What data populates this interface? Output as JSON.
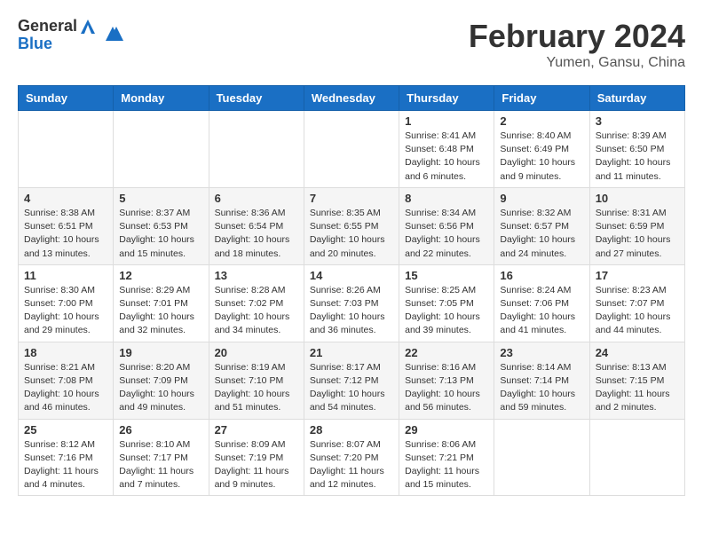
{
  "header": {
    "logo_general": "General",
    "logo_blue": "Blue",
    "month_title": "February 2024",
    "subtitle": "Yumen, Gansu, China"
  },
  "weekdays": [
    "Sunday",
    "Monday",
    "Tuesday",
    "Wednesday",
    "Thursday",
    "Friday",
    "Saturday"
  ],
  "weeks": [
    [
      {
        "day": "",
        "info": ""
      },
      {
        "day": "",
        "info": ""
      },
      {
        "day": "",
        "info": ""
      },
      {
        "day": "",
        "info": ""
      },
      {
        "day": "1",
        "info": "Sunrise: 8:41 AM\nSunset: 6:48 PM\nDaylight: 10 hours\nand 6 minutes."
      },
      {
        "day": "2",
        "info": "Sunrise: 8:40 AM\nSunset: 6:49 PM\nDaylight: 10 hours\nand 9 minutes."
      },
      {
        "day": "3",
        "info": "Sunrise: 8:39 AM\nSunset: 6:50 PM\nDaylight: 10 hours\nand 11 minutes."
      }
    ],
    [
      {
        "day": "4",
        "info": "Sunrise: 8:38 AM\nSunset: 6:51 PM\nDaylight: 10 hours\nand 13 minutes."
      },
      {
        "day": "5",
        "info": "Sunrise: 8:37 AM\nSunset: 6:53 PM\nDaylight: 10 hours\nand 15 minutes."
      },
      {
        "day": "6",
        "info": "Sunrise: 8:36 AM\nSunset: 6:54 PM\nDaylight: 10 hours\nand 18 minutes."
      },
      {
        "day": "7",
        "info": "Sunrise: 8:35 AM\nSunset: 6:55 PM\nDaylight: 10 hours\nand 20 minutes."
      },
      {
        "day": "8",
        "info": "Sunrise: 8:34 AM\nSunset: 6:56 PM\nDaylight: 10 hours\nand 22 minutes."
      },
      {
        "day": "9",
        "info": "Sunrise: 8:32 AM\nSunset: 6:57 PM\nDaylight: 10 hours\nand 24 minutes."
      },
      {
        "day": "10",
        "info": "Sunrise: 8:31 AM\nSunset: 6:59 PM\nDaylight: 10 hours\nand 27 minutes."
      }
    ],
    [
      {
        "day": "11",
        "info": "Sunrise: 8:30 AM\nSunset: 7:00 PM\nDaylight: 10 hours\nand 29 minutes."
      },
      {
        "day": "12",
        "info": "Sunrise: 8:29 AM\nSunset: 7:01 PM\nDaylight: 10 hours\nand 32 minutes."
      },
      {
        "day": "13",
        "info": "Sunrise: 8:28 AM\nSunset: 7:02 PM\nDaylight: 10 hours\nand 34 minutes."
      },
      {
        "day": "14",
        "info": "Sunrise: 8:26 AM\nSunset: 7:03 PM\nDaylight: 10 hours\nand 36 minutes."
      },
      {
        "day": "15",
        "info": "Sunrise: 8:25 AM\nSunset: 7:05 PM\nDaylight: 10 hours\nand 39 minutes."
      },
      {
        "day": "16",
        "info": "Sunrise: 8:24 AM\nSunset: 7:06 PM\nDaylight: 10 hours\nand 41 minutes."
      },
      {
        "day": "17",
        "info": "Sunrise: 8:23 AM\nSunset: 7:07 PM\nDaylight: 10 hours\nand 44 minutes."
      }
    ],
    [
      {
        "day": "18",
        "info": "Sunrise: 8:21 AM\nSunset: 7:08 PM\nDaylight: 10 hours\nand 46 minutes."
      },
      {
        "day": "19",
        "info": "Sunrise: 8:20 AM\nSunset: 7:09 PM\nDaylight: 10 hours\nand 49 minutes."
      },
      {
        "day": "20",
        "info": "Sunrise: 8:19 AM\nSunset: 7:10 PM\nDaylight: 10 hours\nand 51 minutes."
      },
      {
        "day": "21",
        "info": "Sunrise: 8:17 AM\nSunset: 7:12 PM\nDaylight: 10 hours\nand 54 minutes."
      },
      {
        "day": "22",
        "info": "Sunrise: 8:16 AM\nSunset: 7:13 PM\nDaylight: 10 hours\nand 56 minutes."
      },
      {
        "day": "23",
        "info": "Sunrise: 8:14 AM\nSunset: 7:14 PM\nDaylight: 10 hours\nand 59 minutes."
      },
      {
        "day": "24",
        "info": "Sunrise: 8:13 AM\nSunset: 7:15 PM\nDaylight: 11 hours\nand 2 minutes."
      }
    ],
    [
      {
        "day": "25",
        "info": "Sunrise: 8:12 AM\nSunset: 7:16 PM\nDaylight: 11 hours\nand 4 minutes."
      },
      {
        "day": "26",
        "info": "Sunrise: 8:10 AM\nSunset: 7:17 PM\nDaylight: 11 hours\nand 7 minutes."
      },
      {
        "day": "27",
        "info": "Sunrise: 8:09 AM\nSunset: 7:19 PM\nDaylight: 11 hours\nand 9 minutes."
      },
      {
        "day": "28",
        "info": "Sunrise: 8:07 AM\nSunset: 7:20 PM\nDaylight: 11 hours\nand 12 minutes."
      },
      {
        "day": "29",
        "info": "Sunrise: 8:06 AM\nSunset: 7:21 PM\nDaylight: 11 hours\nand 15 minutes."
      },
      {
        "day": "",
        "info": ""
      },
      {
        "day": "",
        "info": ""
      }
    ]
  ]
}
